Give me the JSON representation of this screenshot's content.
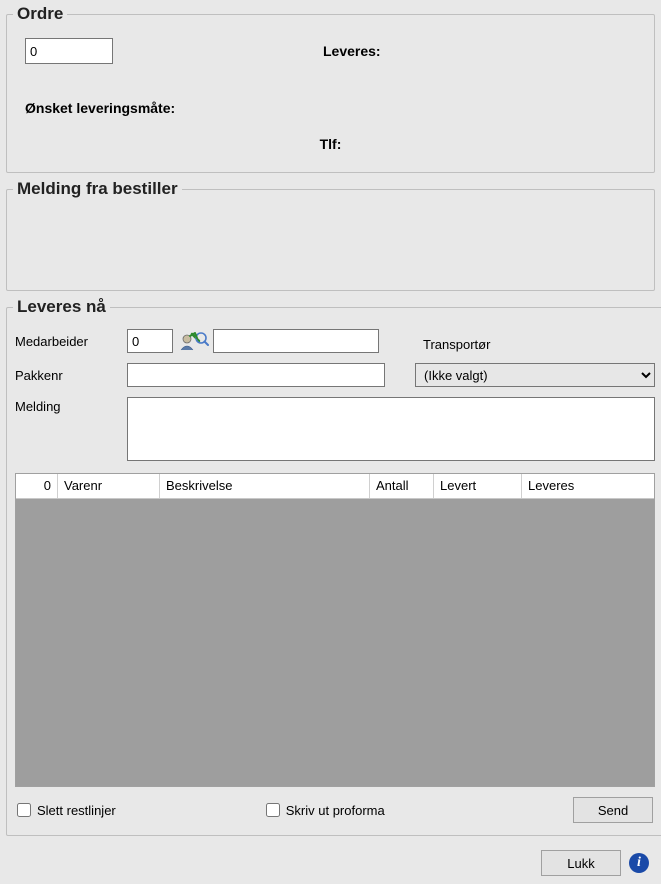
{
  "ordre": {
    "legend": "Ordre",
    "number": "0",
    "leveres_label": "Leveres:",
    "onsket_label": "Ønsket leveringsmåte:",
    "tlf_label": "Tlf:"
  },
  "melding_bestiller": {
    "legend": "Melding fra bestiller"
  },
  "leveres_na": {
    "legend": "Leveres nå",
    "medarbeider_label": "Medarbeider",
    "medarbeider_value": "0",
    "medarbeider_name": "",
    "pakkenr_label": "Pakkenr",
    "pakkenr_value": "",
    "transportor_label": "Transportør",
    "transportor_selected": "(Ikke valgt)",
    "melding_label": "Melding",
    "melding_value": ""
  },
  "table": {
    "columns": [
      "0",
      "Varenr",
      "Beskrivelse",
      "Antall",
      "Levert",
      "Leveres"
    ],
    "rows": []
  },
  "checkboxes": {
    "slett_restlinjer": {
      "label": "Slett restlinjer",
      "checked": false
    },
    "skriv_ut_proforma": {
      "label": "Skriv ut proforma",
      "checked": false
    }
  },
  "buttons": {
    "send": "Send",
    "lukk": "Lukk"
  },
  "icons": {
    "info": "i"
  }
}
